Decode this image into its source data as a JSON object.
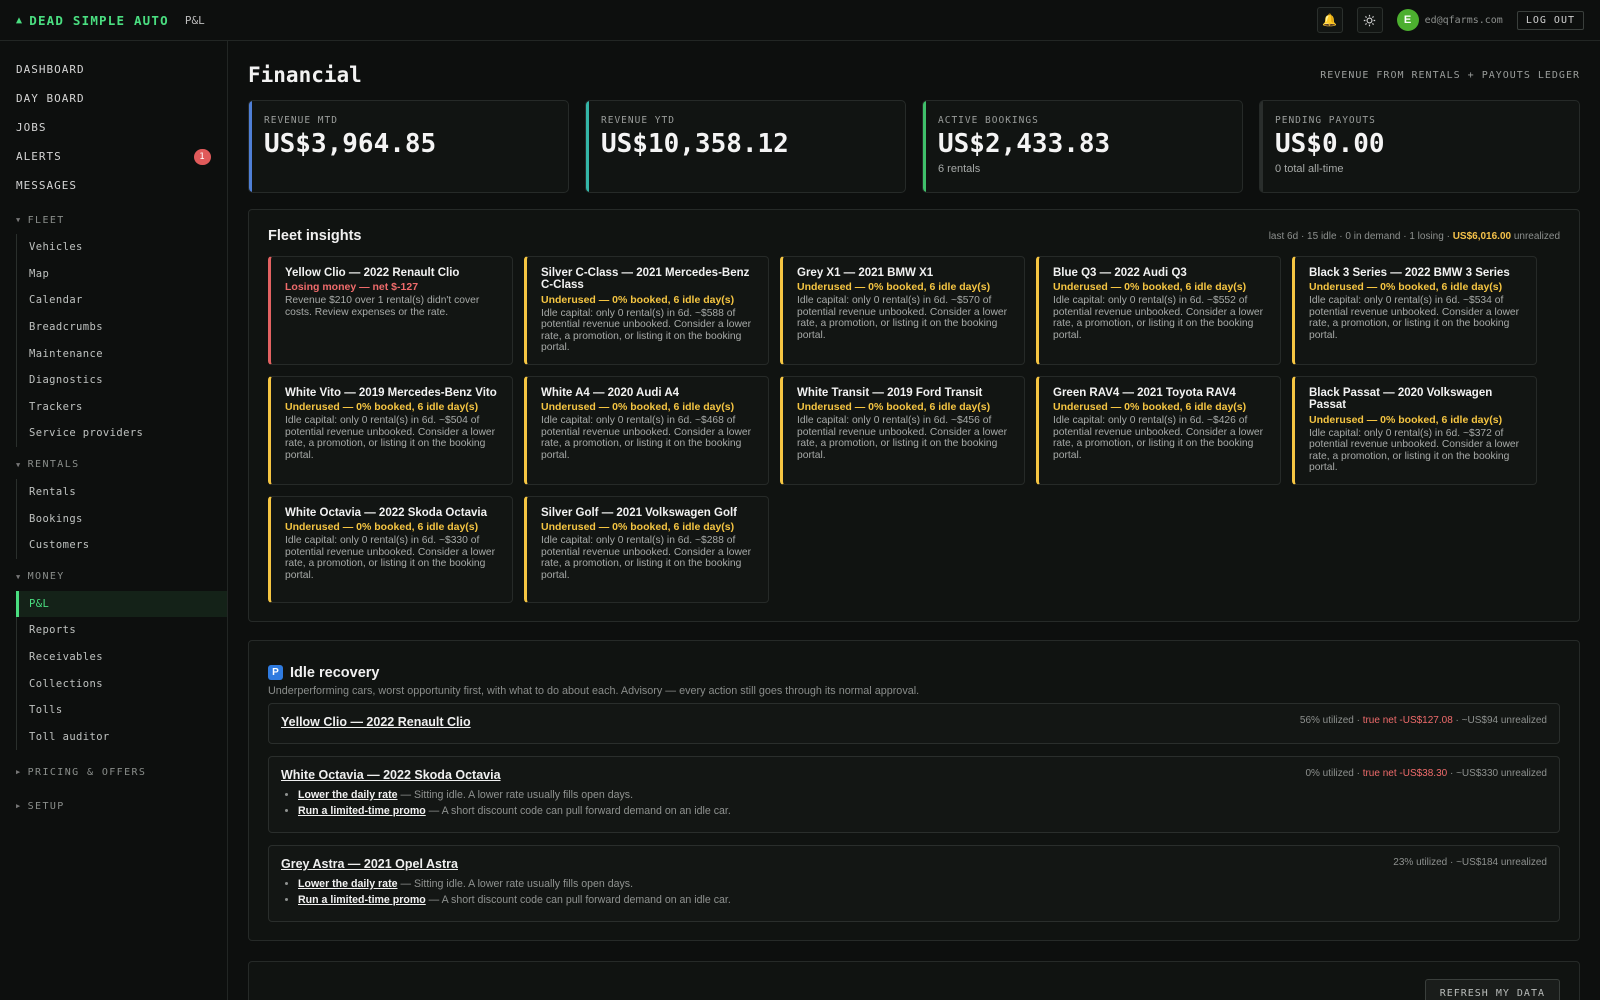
{
  "app": {
    "brand": "DEAD SIMPLE AUTO",
    "brand_section": "P&L",
    "user_initial": "E",
    "user_email": "ed@qfarms.com",
    "logout_label": "LOG OUT",
    "accent_color": "#4ade80"
  },
  "nav": {
    "top": [
      {
        "label": "DASHBOARD"
      },
      {
        "label": "DAY BOARD"
      },
      {
        "label": "JOBS"
      },
      {
        "label": "ALERTS",
        "badge": "1"
      },
      {
        "label": "MESSAGES"
      }
    ],
    "fleet": {
      "label": "FLEET",
      "items": [
        "Vehicles",
        "Map",
        "Calendar",
        "Breadcrumbs",
        "Maintenance",
        "Diagnostics",
        "Trackers",
        "Service providers"
      ]
    },
    "rentals": {
      "label": "RENTALS",
      "items": [
        "Rentals",
        "Bookings",
        "Customers"
      ]
    },
    "money": {
      "label": "MONEY",
      "items": [
        "P&L",
        "Reports",
        "Receivables",
        "Collections",
        "Tolls",
        "Toll auditor"
      ],
      "active": "P&L"
    },
    "pricing_label": "PRICING & OFFERS",
    "setup_label": "SETUP"
  },
  "page": {
    "title": "Financial",
    "subtitle": "REVENUE FROM RENTALS + PAYOUTS LEDGER"
  },
  "kpis": [
    {
      "label": "REVENUE MTD",
      "value": "US$3,964.85",
      "note": "",
      "accent": "#4f7fd6"
    },
    {
      "label": "REVENUE YTD",
      "value": "US$10,358.12",
      "note": "",
      "accent": "#34b6a8"
    },
    {
      "label": "ACTIVE BOOKINGS",
      "value": "US$2,433.83",
      "note": "6 rentals",
      "accent": "#3fbf6a"
    },
    {
      "label": "PENDING PAYOUTS",
      "value": "US$0.00",
      "note": "0 total all-time",
      "accent": "#2a2e2c"
    }
  ],
  "fleet_insights": {
    "title": "Fleet insights",
    "meta_prefix": "last 6d · 15 idle · 0 in demand · 1 losing · ",
    "meta_amount": "US$6,016.00",
    "meta_suffix": " unrealized",
    "cards": [
      {
        "title": "Yellow Clio — 2022 Renault Clio",
        "status": "Losing money — net $-127",
        "desc": "Revenue $210 over 1 rental(s) didn't cover costs. Review expenses or the rate.",
        "tone": "red"
      },
      {
        "title": "Silver C-Class — 2021 Mercedes-Benz C-Class",
        "status": "Underused — 0% booked, 6 idle day(s)",
        "desc": "Idle capital: only 0 rental(s) in 6d. ~$588 of potential revenue unbooked. Consider a lower rate, a promotion, or listing it on the booking portal.",
        "tone": "yellow"
      },
      {
        "title": "Grey X1 — 2021 BMW X1",
        "status": "Underused — 0% booked, 6 idle day(s)",
        "desc": "Idle capital: only 0 rental(s) in 6d. ~$570 of potential revenue unbooked. Consider a lower rate, a promotion, or listing it on the booking portal.",
        "tone": "yellow"
      },
      {
        "title": "Blue Q3 — 2022 Audi Q3",
        "status": "Underused — 0% booked, 6 idle day(s)",
        "desc": "Idle capital: only 0 rental(s) in 6d. ~$552 of potential revenue unbooked. Consider a lower rate, a promotion, or listing it on the booking portal.",
        "tone": "yellow"
      },
      {
        "title": "Black 3 Series — 2022 BMW 3 Series",
        "status": "Underused — 0% booked, 6 idle day(s)",
        "desc": "Idle capital: only 0 rental(s) in 6d. ~$534 of potential revenue unbooked. Consider a lower rate, a promotion, or listing it on the booking portal.",
        "tone": "yellow"
      },
      {
        "title": "White Vito — 2019 Mercedes-Benz Vito",
        "status": "Underused — 0% booked, 6 idle day(s)",
        "desc": "Idle capital: only 0 rental(s) in 6d. ~$504 of potential revenue unbooked. Consider a lower rate, a promotion, or listing it on the booking portal.",
        "tone": "yellow"
      },
      {
        "title": "White A4 — 2020 Audi A4",
        "status": "Underused — 0% booked, 6 idle day(s)",
        "desc": "Idle capital: only 0 rental(s) in 6d. ~$468 of potential revenue unbooked. Consider a lower rate, a promotion, or listing it on the booking portal.",
        "tone": "yellow"
      },
      {
        "title": "White Transit — 2019 Ford Transit",
        "status": "Underused — 0% booked, 6 idle day(s)",
        "desc": "Idle capital: only 0 rental(s) in 6d. ~$456 of potential revenue unbooked. Consider a lower rate, a promotion, or listing it on the booking portal.",
        "tone": "yellow"
      },
      {
        "title": "Green RAV4 — 2021 Toyota RAV4",
        "status": "Underused — 0% booked, 6 idle day(s)",
        "desc": "Idle capital: only 0 rental(s) in 6d. ~$426 of potential revenue unbooked. Consider a lower rate, a promotion, or listing it on the booking portal.",
        "tone": "yellow"
      },
      {
        "title": "Black Passat — 2020 Volkswagen Passat",
        "status": "Underused — 0% booked, 6 idle day(s)",
        "desc": "Idle capital: only 0 rental(s) in 6d. ~$372 of potential revenue unbooked. Consider a lower rate, a promotion, or listing it on the booking portal.",
        "tone": "yellow"
      },
      {
        "title": "White Octavia — 2022 Skoda Octavia",
        "status": "Underused — 0% booked, 6 idle day(s)",
        "desc": "Idle capital: only 0 rental(s) in 6d. ~$330 of potential revenue unbooked. Consider a lower rate, a promotion, or listing it on the booking portal.",
        "tone": "yellow"
      },
      {
        "title": "Silver Golf — 2021 Volkswagen Golf",
        "status": "Underused — 0% booked, 6 idle day(s)",
        "desc": "Idle capital: only 0 rental(s) in 6d. ~$288 of potential revenue unbooked. Consider a lower rate, a promotion, or listing it on the booking portal.",
        "tone": "yellow"
      }
    ]
  },
  "idle_recovery": {
    "icon": "P",
    "title": "Idle recovery",
    "desc": "Underperforming cars, worst opportunity first, with what to do about each. Advisory — every action still goes through its normal approval.",
    "items": [
      {
        "title": "Yellow Clio — 2022 Renault Clio",
        "util": "56% utilized · ",
        "net": "true net -US$127.08",
        "unrealized": " · ~US$94 unrealized",
        "actions": []
      },
      {
        "title": "White Octavia — 2022 Skoda Octavia",
        "util": "0% utilized · ",
        "net": "true net -US$38.30",
        "unrealized": " · ~US$330 unrealized",
        "actions": [
          {
            "label": "Lower the daily rate",
            "desc": " — Sitting idle. A lower rate usually fills open days."
          },
          {
            "label": "Run a limited-time promo",
            "desc": " — A short discount code can pull forward demand on an idle car."
          }
        ]
      },
      {
        "title": "Grey Astra — 2021 Opel Astra",
        "util": "23% utilized · ~US$184 unrealized",
        "net": "",
        "unrealized": "",
        "actions": [
          {
            "label": "Lower the daily rate",
            "desc": " — Sitting idle. A lower rate usually fills open days."
          },
          {
            "label": "Run a limited-time promo",
            "desc": " — A short discount code can pull forward demand on an idle car."
          }
        ]
      }
    ]
  },
  "bottom_panel": {
    "refresh_label": "REFRESH MY DATA"
  }
}
